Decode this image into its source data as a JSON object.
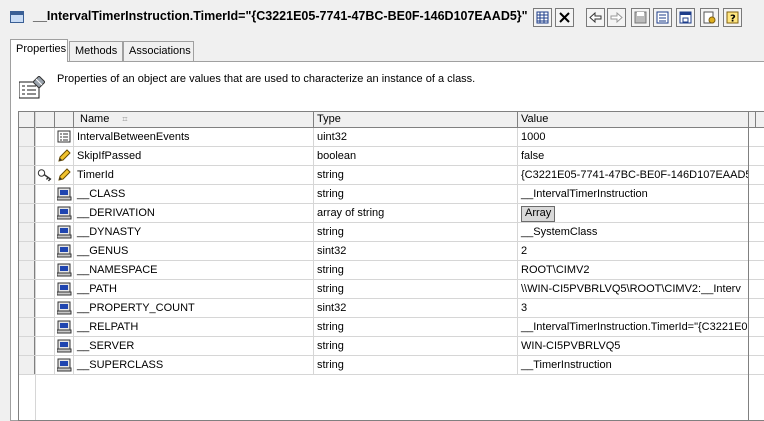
{
  "window": {
    "title": "__IntervalTimerInstruction.TimerId=\"{C3221E05-7741-47BC-BE0F-146D107EAAD5}\"",
    "toolbar": [
      "grid-icon",
      "close-icon",
      "back-icon",
      "forward-icon",
      "save-icon",
      "properties-icon",
      "window-icon",
      "permissions-icon",
      "help-icon"
    ]
  },
  "tabs": [
    {
      "label": "Properties",
      "active": true
    },
    {
      "label": "Methods",
      "active": false
    },
    {
      "label": "Associations",
      "active": false
    }
  ],
  "description": "Properties of an object are values that are used to characterize an instance of a class.",
  "grid": {
    "headers": {
      "name": "Name",
      "type": "Type",
      "value": "Value"
    },
    "rows": [
      {
        "key": false,
        "icon": "property-icon",
        "name": "IntervalBetweenEvents",
        "type": "uint32",
        "value": "1000"
      },
      {
        "key": false,
        "icon": "pencil-icon",
        "name": "SkipIfPassed",
        "type": "boolean",
        "value": "false"
      },
      {
        "key": true,
        "icon": "pencil-icon",
        "name": "TimerId",
        "type": "string",
        "value": "{C3221E05-7741-47BC-BE0F-146D107EAAD5"
      },
      {
        "key": false,
        "icon": "system-icon",
        "name": "__CLASS",
        "type": "string",
        "value": "__IntervalTimerInstruction"
      },
      {
        "key": false,
        "icon": "system-icon",
        "name": "__DERIVATION",
        "type": "array of string",
        "value": "Array",
        "is_button": true
      },
      {
        "key": false,
        "icon": "system-icon",
        "name": "__DYNASTY",
        "type": "string",
        "value": "__SystemClass"
      },
      {
        "key": false,
        "icon": "system-icon",
        "name": "__GENUS",
        "type": "sint32",
        "value": "2"
      },
      {
        "key": false,
        "icon": "system-icon",
        "name": "__NAMESPACE",
        "type": "string",
        "value": "ROOT\\CIMV2"
      },
      {
        "key": false,
        "icon": "system-icon",
        "name": "__PATH",
        "type": "string",
        "value": "\\\\WIN-CI5PVBRLVQ5\\ROOT\\CIMV2:__Interv"
      },
      {
        "key": false,
        "icon": "system-icon",
        "name": "__PROPERTY_COUNT",
        "type": "sint32",
        "value": "3"
      },
      {
        "key": false,
        "icon": "system-icon",
        "name": "__RELPATH",
        "type": "string",
        "value": "__IntervalTimerInstruction.TimerId=\"{C3221E0"
      },
      {
        "key": false,
        "icon": "system-icon",
        "name": "__SERVER",
        "type": "string",
        "value": "WIN-CI5PVBRLVQ5"
      },
      {
        "key": false,
        "icon": "system-icon",
        "name": "__SUPERCLASS",
        "type": "string",
        "value": "__TimerInstruction"
      }
    ]
  }
}
